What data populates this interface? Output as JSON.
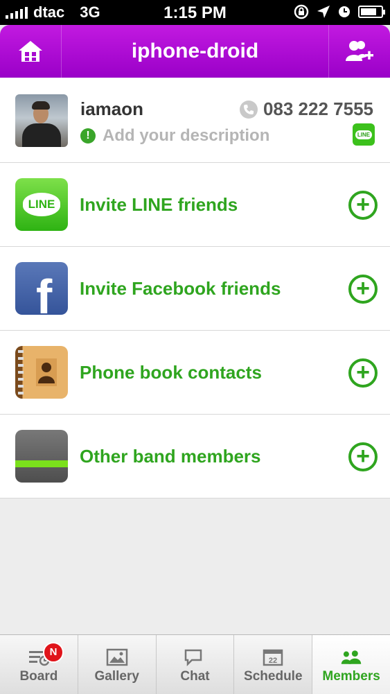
{
  "status_bar": {
    "carrier": "dtac",
    "network": "3G",
    "time": "1:15 PM",
    "battery_level": 0.8
  },
  "header": {
    "title": "iphone-droid",
    "left_icon": "home-icon",
    "right_icon": "add-member-icon"
  },
  "profile": {
    "name": "iamaon",
    "phone": "083 222 7555",
    "description_placeholder": "Add your description",
    "badge_text": "LINE"
  },
  "actions": [
    {
      "label": "Invite LINE friends",
      "icon": "line-icon",
      "icon_text": "LINE"
    },
    {
      "label": "Invite Facebook friends",
      "icon": "facebook-icon",
      "icon_text": "f"
    },
    {
      "label": "Phone book contacts",
      "icon": "contacts-book-icon"
    },
    {
      "label": "Other band members",
      "icon": "band-icon"
    }
  ],
  "tabbar": {
    "tabs": [
      {
        "label": "Board",
        "icon": "board-icon",
        "badge": "N"
      },
      {
        "label": "Gallery",
        "icon": "gallery-icon"
      },
      {
        "label": "Chat",
        "icon": "chat-icon"
      },
      {
        "label": "Schedule",
        "icon": "calendar-icon",
        "icon_text": "22"
      },
      {
        "label": "Members",
        "icon": "members-icon",
        "active": true
      }
    ]
  },
  "colors": {
    "header_purple": "#b010d8",
    "accent_green": "#2fa51f"
  }
}
